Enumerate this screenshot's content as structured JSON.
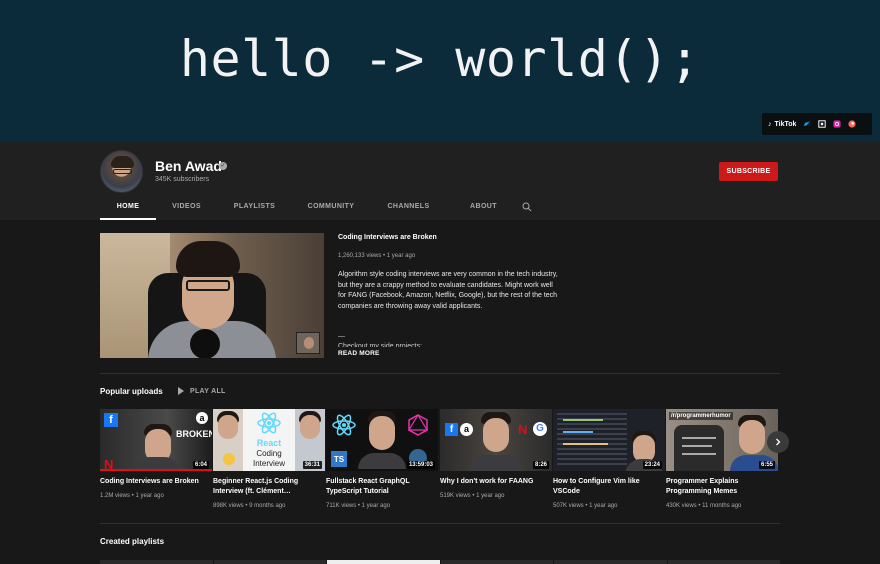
{
  "banner": {
    "text": "hello -> world();"
  },
  "social": {
    "tiktok_label": "TikTok",
    "icons": [
      "tiktok-icon",
      "twitter-icon",
      "instagram-icon",
      "camera-icon",
      "patreon-icon"
    ]
  },
  "channel": {
    "name": "Ben Awad",
    "subscribers": "345K subscribers",
    "subscribe_label": "SUBSCRIBE"
  },
  "tabs": [
    {
      "label": "HOME",
      "active": true
    },
    {
      "label": "VIDEOS"
    },
    {
      "label": "PLAYLISTS"
    },
    {
      "label": "COMMUNITY"
    },
    {
      "label": "CHANNELS"
    },
    {
      "label": "ABOUT"
    }
  ],
  "featured": {
    "title": "Coding Interviews are Broken",
    "meta": "1,260,133 views • 1 year ago",
    "description": "Algorithm style coding interviews are very common in the tech industry, but they are a crappy method to evaluate candidates. Might work well for FANG (Facebook, Amazon, Netflix, Google), but the rest of the tech companies are throwing away valid applicants.",
    "dash": "—",
    "checkout": "Checkout my side projects:",
    "read_more": "READ MORE"
  },
  "popular": {
    "title": "Popular uploads",
    "play_all": "PLAY ALL",
    "videos": [
      {
        "title": "Coding Interviews are Broken",
        "meta": "1.2M views • 1 year ago",
        "duration": "6:04",
        "thumb_text": "BROKEN"
      },
      {
        "title": "Beginner React.js Coding Interview (ft. Clément…",
        "meta": "898K views • 9 months ago",
        "duration": "36:31",
        "thumb_text_1": "React",
        "thumb_text_2": "Coding",
        "thumb_text_3": "Interview"
      },
      {
        "title": "Fullstack React GraphQL TypeScript Tutorial",
        "meta": "711K views • 1 year ago",
        "duration": "13:59:03",
        "thumb_text": "TS"
      },
      {
        "title": "Why I don't work for FAANG",
        "meta": "519K views • 1 year ago",
        "duration": "8:26"
      },
      {
        "title": "How to Configure Vim like VSCode",
        "meta": "507K views • 1 year ago",
        "duration": "23:24"
      },
      {
        "title": "Programmer Explains Programming Memes",
        "meta": "430K views • 11 months ago",
        "duration": "6:55",
        "thumb_text": "/r/programmerhumor"
      }
    ]
  },
  "playlists": {
    "title": "Created playlists"
  },
  "colors": {
    "banner_bg": "#0b2a3a",
    "page_bg": "#181818",
    "header_bg": "#202020",
    "subscribe": "#cc1a1a"
  }
}
